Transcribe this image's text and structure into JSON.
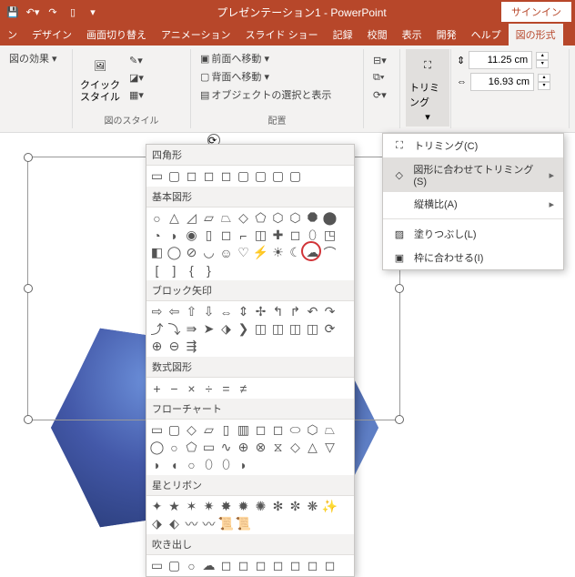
{
  "titlebar": {
    "title": "プレゼンテーション1 - PowerPoint",
    "signin": "サインイン"
  },
  "tabs": [
    "ン",
    "デザイン",
    "画面切り替え",
    "アニメーション",
    "スライド ショー",
    "記録",
    "校閲",
    "表示",
    "開発",
    "ヘルプ",
    "図の形式"
  ],
  "activeTab": 10,
  "ribbon": {
    "effect": "図の効果 ▾",
    "quickstyle": "クイック\nスタイル",
    "styleGroup": "図のスタイル",
    "front": "前面へ移動 ▾",
    "back": "背面へ移動 ▾",
    "selpane": "オブジェクトの選択と表示",
    "arrangeGroup": "配置",
    "trim": "トリミング",
    "height": "11.25 cm",
    "width": "16.93 cm"
  },
  "submenu": {
    "trimC": "トリミング(C)",
    "cropToShape": "図形に合わせてトリミング(S)",
    "aspect": "縦横比(A)",
    "fill": "塗りつぶし(L)",
    "fit": "枠に合わせる(I)"
  },
  "shapes": {
    "rect": "四角形",
    "basic": "基本図形",
    "block": "ブロック矢印",
    "equation": "数式図形",
    "flow": "フローチャート",
    "star": "星とリボン",
    "callout": "吹き出し"
  }
}
